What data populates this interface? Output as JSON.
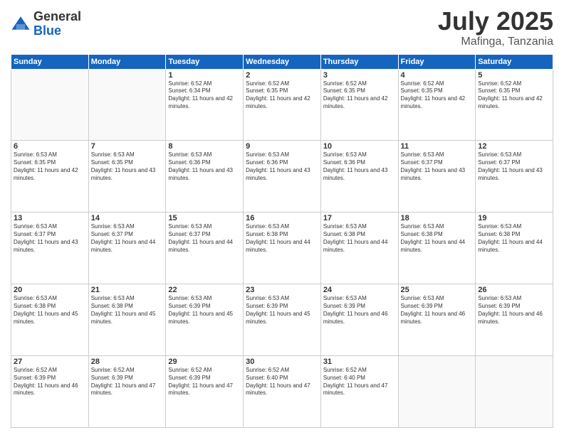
{
  "logo": {
    "general": "General",
    "blue": "Blue"
  },
  "header": {
    "month": "July 2025",
    "location": "Mafinga, Tanzania"
  },
  "weekdays": [
    "Sunday",
    "Monday",
    "Tuesday",
    "Wednesday",
    "Thursday",
    "Friday",
    "Saturday"
  ],
  "weeks": [
    [
      {
        "num": "",
        "empty": true
      },
      {
        "num": "",
        "empty": true
      },
      {
        "num": "1",
        "sunrise": "6:52 AM",
        "sunset": "6:34 PM",
        "daylight": "11 hours and 42 minutes."
      },
      {
        "num": "2",
        "sunrise": "6:52 AM",
        "sunset": "6:35 PM",
        "daylight": "11 hours and 42 minutes."
      },
      {
        "num": "3",
        "sunrise": "6:52 AM",
        "sunset": "6:35 PM",
        "daylight": "11 hours and 42 minutes."
      },
      {
        "num": "4",
        "sunrise": "6:52 AM",
        "sunset": "6:35 PM",
        "daylight": "11 hours and 42 minutes."
      },
      {
        "num": "5",
        "sunrise": "6:52 AM",
        "sunset": "6:35 PM",
        "daylight": "11 hours and 42 minutes."
      }
    ],
    [
      {
        "num": "6",
        "sunrise": "6:53 AM",
        "sunset": "6:35 PM",
        "daylight": "11 hours and 42 minutes."
      },
      {
        "num": "7",
        "sunrise": "6:53 AM",
        "sunset": "6:35 PM",
        "daylight": "11 hours and 43 minutes."
      },
      {
        "num": "8",
        "sunrise": "6:53 AM",
        "sunset": "6:36 PM",
        "daylight": "11 hours and 43 minutes."
      },
      {
        "num": "9",
        "sunrise": "6:53 AM",
        "sunset": "6:36 PM",
        "daylight": "11 hours and 43 minutes."
      },
      {
        "num": "10",
        "sunrise": "6:53 AM",
        "sunset": "6:36 PM",
        "daylight": "11 hours and 43 minutes."
      },
      {
        "num": "11",
        "sunrise": "6:53 AM",
        "sunset": "6:37 PM",
        "daylight": "11 hours and 43 minutes."
      },
      {
        "num": "12",
        "sunrise": "6:53 AM",
        "sunset": "6:37 PM",
        "daylight": "11 hours and 43 minutes."
      }
    ],
    [
      {
        "num": "13",
        "sunrise": "6:53 AM",
        "sunset": "6:37 PM",
        "daylight": "11 hours and 43 minutes."
      },
      {
        "num": "14",
        "sunrise": "6:53 AM",
        "sunset": "6:37 PM",
        "daylight": "11 hours and 44 minutes."
      },
      {
        "num": "15",
        "sunrise": "6:53 AM",
        "sunset": "6:37 PM",
        "daylight": "11 hours and 44 minutes."
      },
      {
        "num": "16",
        "sunrise": "6:53 AM",
        "sunset": "6:38 PM",
        "daylight": "11 hours and 44 minutes."
      },
      {
        "num": "17",
        "sunrise": "6:53 AM",
        "sunset": "6:38 PM",
        "daylight": "11 hours and 44 minutes."
      },
      {
        "num": "18",
        "sunrise": "6:53 AM",
        "sunset": "6:38 PM",
        "daylight": "11 hours and 44 minutes."
      },
      {
        "num": "19",
        "sunrise": "6:53 AM",
        "sunset": "6:38 PM",
        "daylight": "11 hours and 44 minutes."
      }
    ],
    [
      {
        "num": "20",
        "sunrise": "6:53 AM",
        "sunset": "6:38 PM",
        "daylight": "11 hours and 45 minutes."
      },
      {
        "num": "21",
        "sunrise": "6:53 AM",
        "sunset": "6:38 PM",
        "daylight": "11 hours and 45 minutes."
      },
      {
        "num": "22",
        "sunrise": "6:53 AM",
        "sunset": "6:39 PM",
        "daylight": "11 hours and 45 minutes."
      },
      {
        "num": "23",
        "sunrise": "6:53 AM",
        "sunset": "6:39 PM",
        "daylight": "11 hours and 45 minutes."
      },
      {
        "num": "24",
        "sunrise": "6:53 AM",
        "sunset": "6:39 PM",
        "daylight": "11 hours and 46 minutes."
      },
      {
        "num": "25",
        "sunrise": "6:53 AM",
        "sunset": "6:39 PM",
        "daylight": "11 hours and 46 minutes."
      },
      {
        "num": "26",
        "sunrise": "6:53 AM",
        "sunset": "6:39 PM",
        "daylight": "11 hours and 46 minutes."
      }
    ],
    [
      {
        "num": "27",
        "sunrise": "6:52 AM",
        "sunset": "6:39 PM",
        "daylight": "11 hours and 46 minutes."
      },
      {
        "num": "28",
        "sunrise": "6:52 AM",
        "sunset": "6:39 PM",
        "daylight": "11 hours and 47 minutes."
      },
      {
        "num": "29",
        "sunrise": "6:52 AM",
        "sunset": "6:39 PM",
        "daylight": "11 hours and 47 minutes."
      },
      {
        "num": "30",
        "sunrise": "6:52 AM",
        "sunset": "6:40 PM",
        "daylight": "11 hours and 47 minutes."
      },
      {
        "num": "31",
        "sunrise": "6:52 AM",
        "sunset": "6:40 PM",
        "daylight": "11 hours and 47 minutes."
      },
      {
        "num": "",
        "empty": true
      },
      {
        "num": "",
        "empty": true
      }
    ]
  ]
}
